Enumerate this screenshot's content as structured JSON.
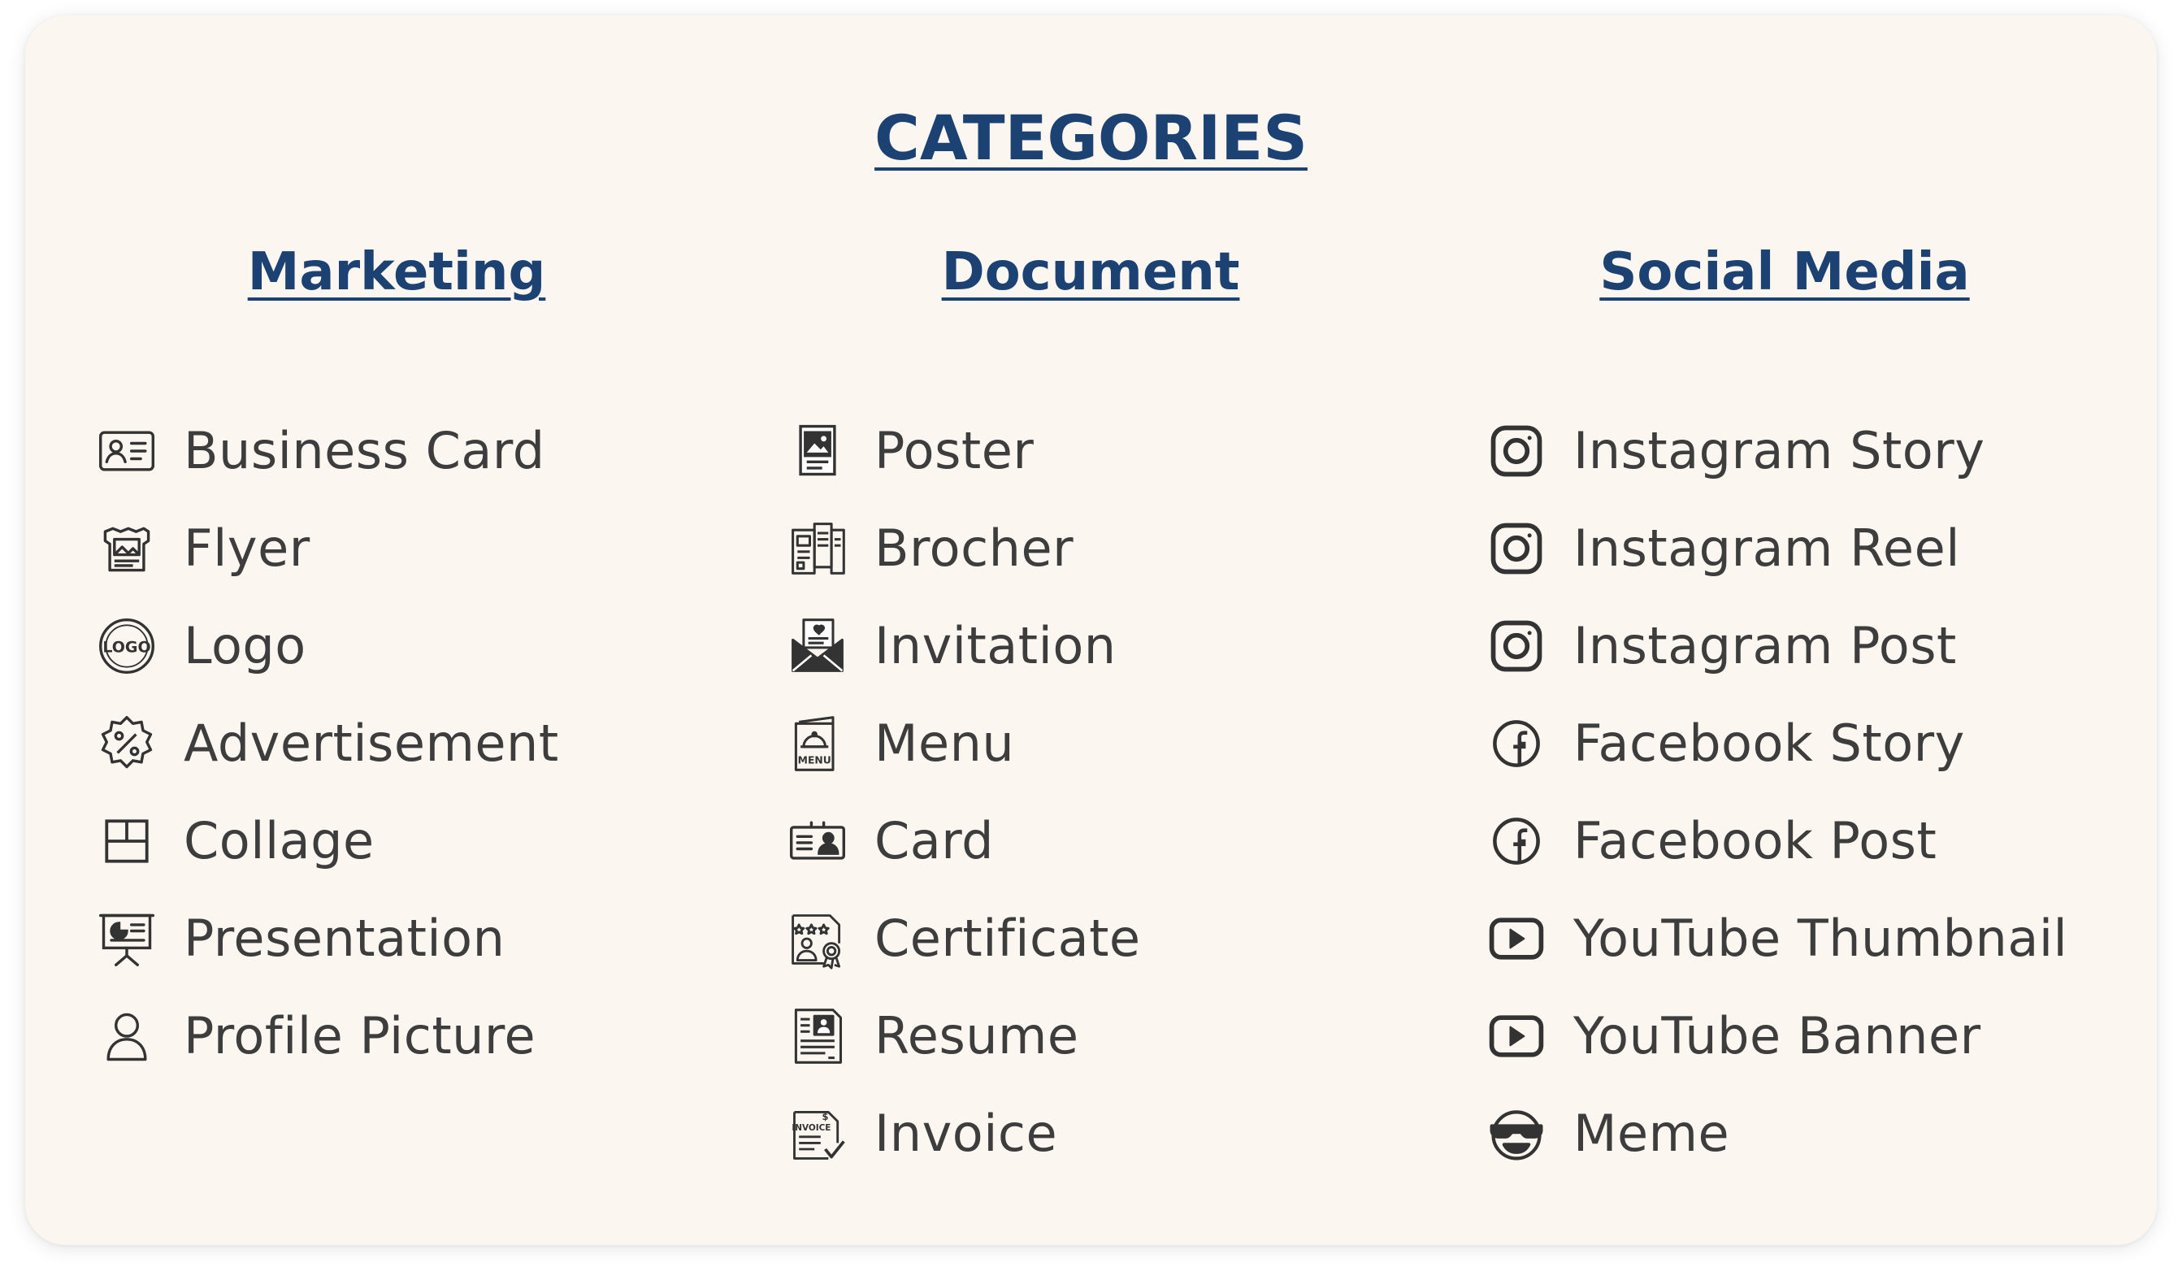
{
  "page": {
    "title": "CATEGORIES"
  },
  "columns": [
    {
      "heading": "Marketing",
      "items": [
        {
          "label": "Business Card",
          "icon": "id-card-icon"
        },
        {
          "label": "Flyer",
          "icon": "flyer-icon"
        },
        {
          "label": "Logo",
          "icon": "logo-badge-icon"
        },
        {
          "label": "Advertisement",
          "icon": "discount-badge-icon"
        },
        {
          "label": "Collage",
          "icon": "collage-grid-icon"
        },
        {
          "label": "Presentation",
          "icon": "presentation-board-icon"
        },
        {
          "label": "Profile Picture",
          "icon": "user-profile-icon"
        }
      ]
    },
    {
      "heading": "Document",
      "items": [
        {
          "label": "Poster",
          "icon": "poster-icon"
        },
        {
          "label": "Brocher",
          "icon": "brochure-icon"
        },
        {
          "label": "Invitation",
          "icon": "invitation-envelope-icon"
        },
        {
          "label": "Menu",
          "icon": "menu-book-icon"
        },
        {
          "label": "Card",
          "icon": "card-icon"
        },
        {
          "label": "Certificate",
          "icon": "certificate-icon"
        },
        {
          "label": "Resume",
          "icon": "resume-icon"
        },
        {
          "label": "Invoice",
          "icon": "invoice-icon"
        }
      ]
    },
    {
      "heading": "Social Media",
      "items": [
        {
          "label": "Instagram Story",
          "icon": "instagram-icon"
        },
        {
          "label": "Instagram Reel",
          "icon": "instagram-icon"
        },
        {
          "label": "Instagram Post",
          "icon": "instagram-icon"
        },
        {
          "label": "Facebook Story",
          "icon": "facebook-icon"
        },
        {
          "label": "Facebook Post",
          "icon": "facebook-icon"
        },
        {
          "label": "YouTube Thumbnail",
          "icon": "youtube-icon"
        },
        {
          "label": "YouTube Banner",
          "icon": "youtube-icon"
        },
        {
          "label": "Meme",
          "icon": "meme-face-icon"
        }
      ]
    }
  ],
  "colors": {
    "heading": "#1b4272",
    "text": "#3d3d3d",
    "card_background": "#fcf6f1",
    "icon": "#333333"
  }
}
